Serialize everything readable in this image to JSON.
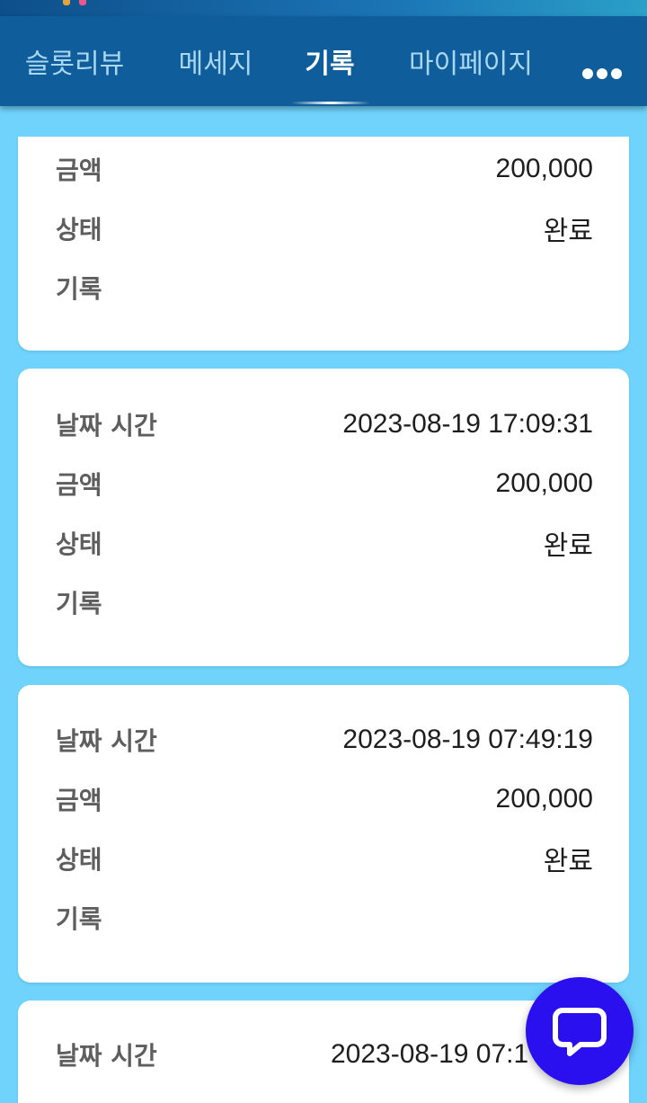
{
  "nav": {
    "tabs": [
      {
        "label": "슬롯리뷰"
      },
      {
        "label": "메세지"
      },
      {
        "label": "기록"
      },
      {
        "label": "마이페이지"
      }
    ],
    "active_tab": "기록",
    "more_icon": "more-horizontal-icon"
  },
  "labels": {
    "datetime": "날짜 시간",
    "amount": "금액",
    "status": "상태",
    "record": "기록"
  },
  "records": [
    {
      "datetime": "",
      "amount": "200,000",
      "status": "완료",
      "record": ""
    },
    {
      "datetime": "2023-08-19 17:09:31",
      "amount": "200,000",
      "status": "완료",
      "record": ""
    },
    {
      "datetime": "2023-08-19 07:49:19",
      "amount": "200,000",
      "status": "완료",
      "record": ""
    },
    {
      "datetime": "2023-08-19 07:1",
      "amount": "",
      "status": "",
      "record": ""
    }
  ],
  "chat": {
    "icon": "chat-bubble-icon"
  },
  "colors": {
    "page_bg": "#6fd3fb",
    "nav_bg": "#0f5d9b",
    "chat_button": "#2a10ee"
  }
}
